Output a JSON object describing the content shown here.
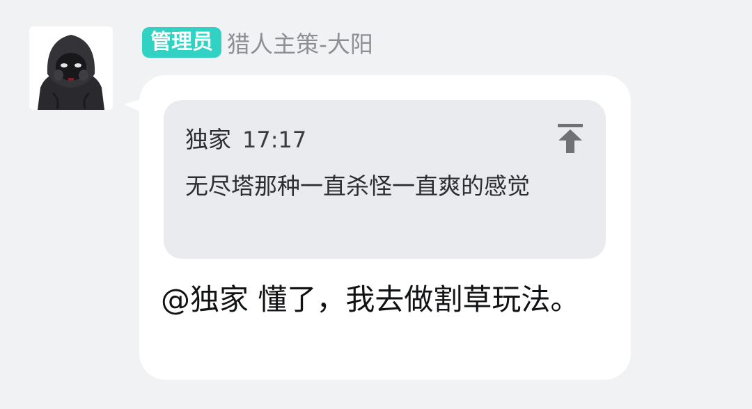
{
  "message": {
    "sender": {
      "role_badge": "管理员",
      "name": "猎人主策-大阳",
      "avatar_icon": "hooded-figure-avatar"
    },
    "quote": {
      "author": "独家",
      "time": "17:17",
      "text": "无尽塔那种一直杀怪一直爽的感觉",
      "jump_icon": "jump-to-original-icon"
    },
    "text": "@独家 懂了，我去做割草玩法。"
  },
  "colors": {
    "page_background": "#f1f2f4",
    "bubble_background": "#ffffff",
    "quote_background": "#e9ebee",
    "badge_background": "#2fd2c3",
    "name_text": "#8d8f94"
  }
}
